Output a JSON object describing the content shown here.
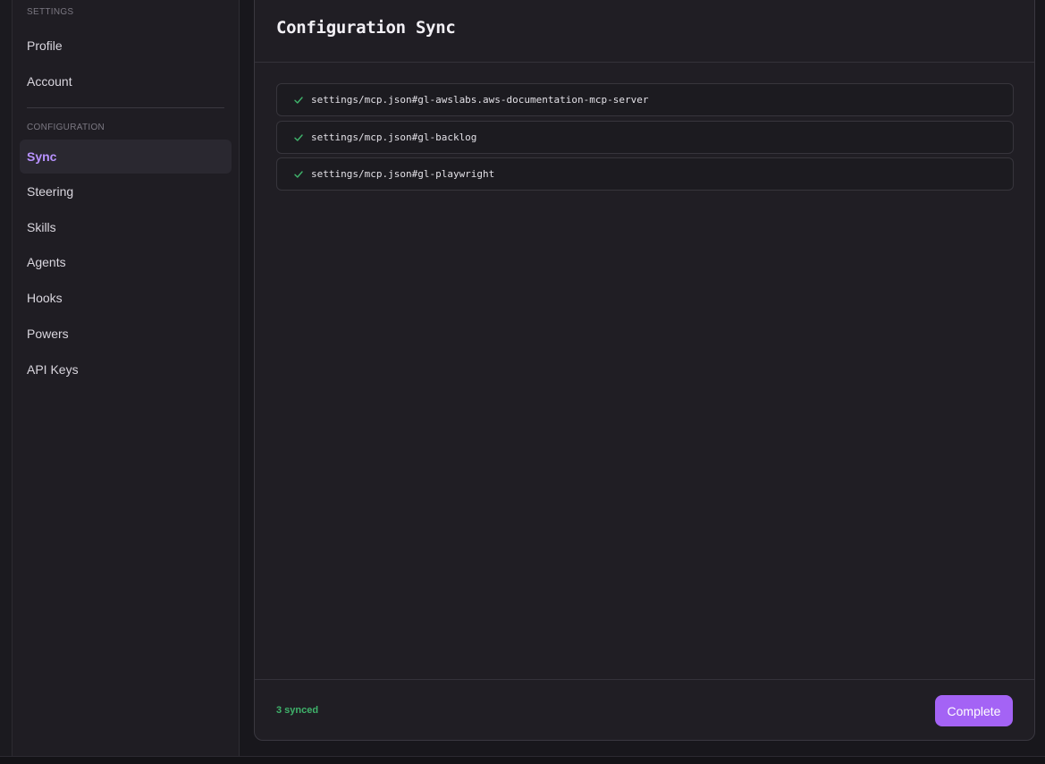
{
  "sidebar": {
    "settings_label": "SETTINGS",
    "configuration_label": "CONFIGURATION",
    "settings_items": [
      {
        "label": "Profile"
      },
      {
        "label": "Account"
      }
    ],
    "configuration_items": [
      {
        "label": "Sync",
        "active": true
      },
      {
        "label": "Steering"
      },
      {
        "label": "Skills"
      },
      {
        "label": "Agents"
      },
      {
        "label": "Hooks"
      },
      {
        "label": "Powers"
      },
      {
        "label": "API Keys"
      }
    ]
  },
  "panel": {
    "title": "Configuration Sync",
    "rows": [
      {
        "path": "settings/mcp.json#gl-awslabs.aws-documentation-mcp-server",
        "status_icon": "check-icon"
      },
      {
        "path": "settings/mcp.json#gl-backlog",
        "status_icon": "check-icon"
      },
      {
        "path": "settings/mcp.json#gl-playwright",
        "status_icon": "check-icon"
      }
    ],
    "footer": {
      "synced_text": "3 synced",
      "complete_label": "Complete"
    }
  },
  "colors": {
    "accent": "#a463f5",
    "active_nav_text": "#b892ff",
    "success": "#3fb36b"
  }
}
